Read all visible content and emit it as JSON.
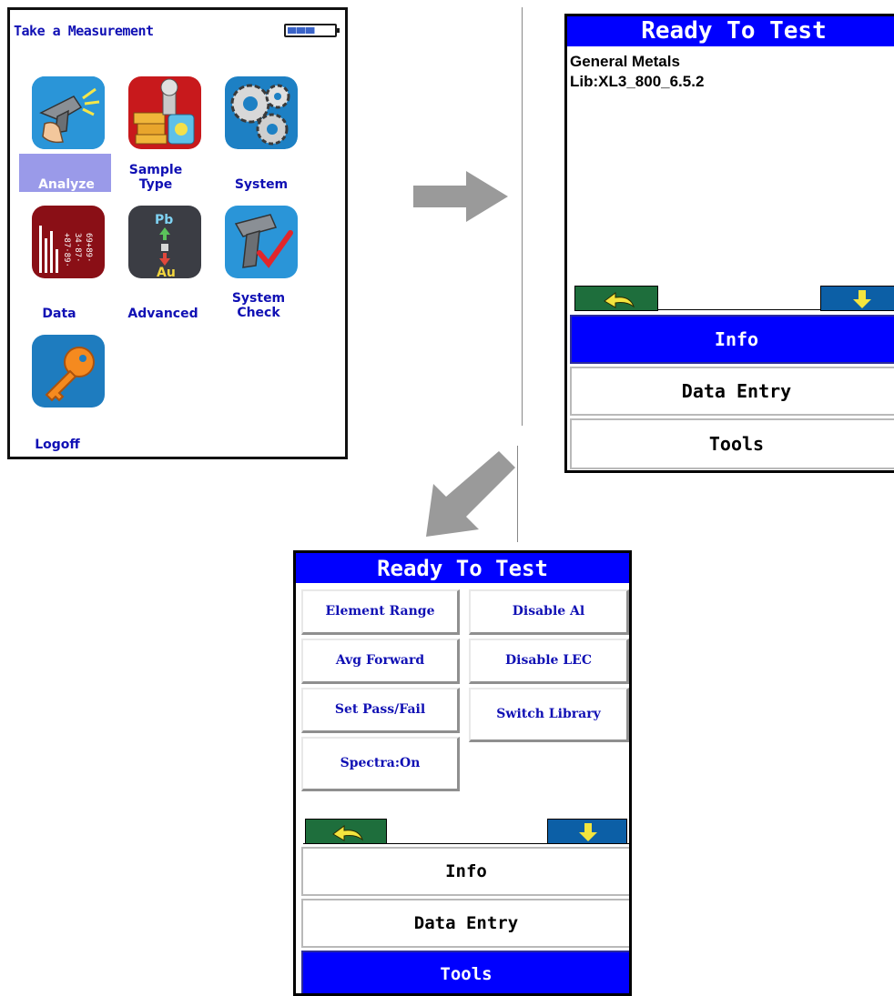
{
  "menu_screen": {
    "title": "Take a Measurement",
    "items": [
      {
        "label": "Analyze",
        "icon": "analyzer-gun-icon",
        "selected": true
      },
      {
        "label": "Sample\nType",
        "icon": "sample-type-icon",
        "selected": false
      },
      {
        "label": "System",
        "icon": "gears-icon",
        "selected": false
      },
      {
        "label": "Data",
        "icon": "data-chart-icon",
        "selected": false
      },
      {
        "label": "Advanced",
        "icon": "pb-au-advanced-icon",
        "selected": false
      },
      {
        "label": "System\nCheck",
        "icon": "system-check-icon",
        "selected": false
      },
      {
        "label": "Logoff",
        "icon": "key-icon",
        "selected": false
      }
    ]
  },
  "ready_screen": {
    "header": "Ready To Test",
    "mode": "General Metals",
    "library": "Lib:XL3_800_6.5.2",
    "menu": [
      {
        "label": "Info",
        "active": true
      },
      {
        "label": "Data Entry",
        "active": false
      },
      {
        "label": "Tools",
        "active": false
      }
    ]
  },
  "tools_screen": {
    "header": "Ready To Test",
    "buttons_left": [
      "Element Range",
      "Avg Forward",
      "Set Pass/Fail",
      "Spectra:On"
    ],
    "buttons_right": [
      "Disable Al",
      "Disable LEC",
      "Switch Library"
    ],
    "menu": [
      {
        "label": "Info",
        "active": false
      },
      {
        "label": "Data Entry",
        "active": false
      },
      {
        "label": "Tools",
        "active": true
      }
    ]
  },
  "colors": {
    "header_blue": "#0000ff",
    "label_blue": "#1010b4",
    "highlight": "#9a9ae9",
    "arrow_gray": "#9a9a9a"
  }
}
